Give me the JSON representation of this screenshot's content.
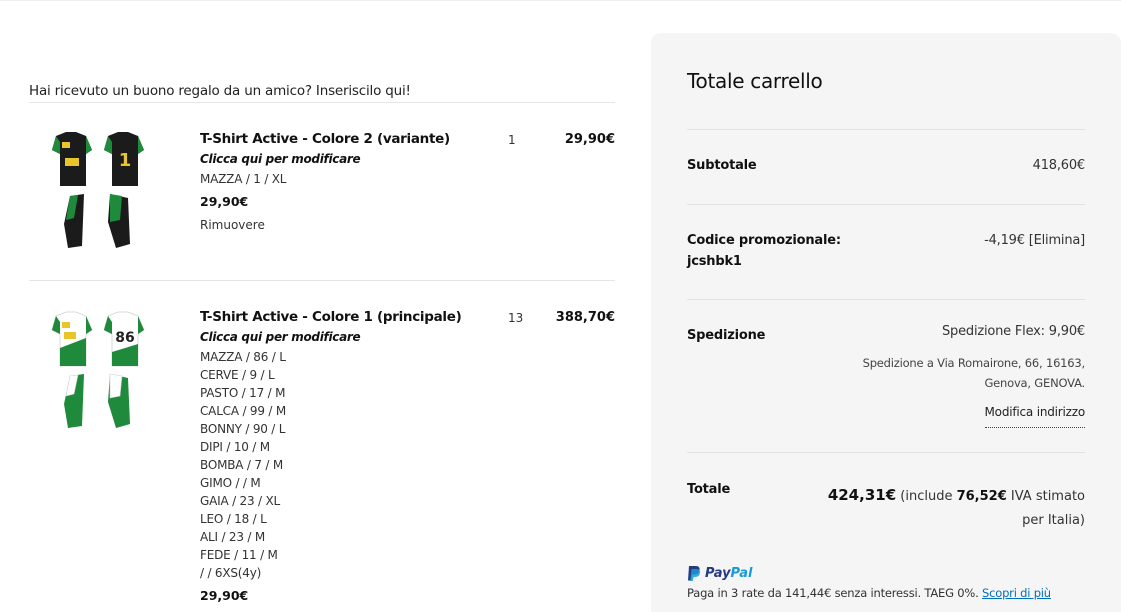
{
  "cart": {
    "gift_prompt": "Hai ricevuto un buono regalo da un amico? Inseriscilo qui!",
    "items": [
      {
        "title": "T-Shirt Active - Colore 2 (variante)",
        "edit_label": "Clicca qui per modificare",
        "variants": [
          "MAZZA / 1 / XL"
        ],
        "unit_price": "29,90€",
        "remove_label": "Rimuovere",
        "quantity": "1",
        "line_total": "29,90€",
        "jersey_number": "1",
        "colors": {
          "body": "#1b1b1b",
          "accent": "#1f8a3b"
        }
      },
      {
        "title": "T-Shirt Active - Colore 1 (principale)",
        "edit_label": "Clicca qui per modificare",
        "variants": [
          "MAZZA / 86 / L",
          "CERVE / 9 / L",
          "PASTO / 17 / M",
          "CALCA / 99 / M",
          "BONNY / 90 / L",
          "DIPI / 10 / M",
          "BOMBA / 7 / M",
          "GIMO / / M",
          "GAIA / 23 / XL",
          "LEO / 18 / L",
          "ALI / 23 / M",
          "FEDE / 11 / M",
          "/ / 6XS(4y)"
        ],
        "unit_price": "29,90€",
        "quantity": "13",
        "line_total": "388,70€",
        "jersey_number": "86",
        "colors": {
          "body": "#ffffff",
          "accent": "#1f8a3b"
        }
      }
    ]
  },
  "summary": {
    "title": "Totale carrello",
    "subtotal_label": "Subtotale",
    "subtotal_value": "418,60€",
    "promo_label": "Codice promozionale:",
    "promo_code": "jcshbk1",
    "promo_value": "-4,19€ [Elimina]",
    "shipping_label": "Spedizione",
    "shipping_method": "Spedizione Flex: 9,90€",
    "shipping_address_line1": "Spedizione a Via Romairone, 66, 16163,",
    "shipping_address_line2": "Genova, GENOVA.",
    "modify_address": "Modifica indirizzo",
    "total_label": "Totale",
    "total_value": "424,31€",
    "total_note_pre": "(include",
    "vat_value": "76,52€",
    "vat_note": "IVA stimato",
    "vat_note_2": "per Italia)"
  },
  "paypal": {
    "brand_1": "Pay",
    "brand_2": "Pal",
    "message": "Paga in 3 rate da 141,44€ senza interessi. TAEG 0%.",
    "link": "Scopri di più"
  }
}
